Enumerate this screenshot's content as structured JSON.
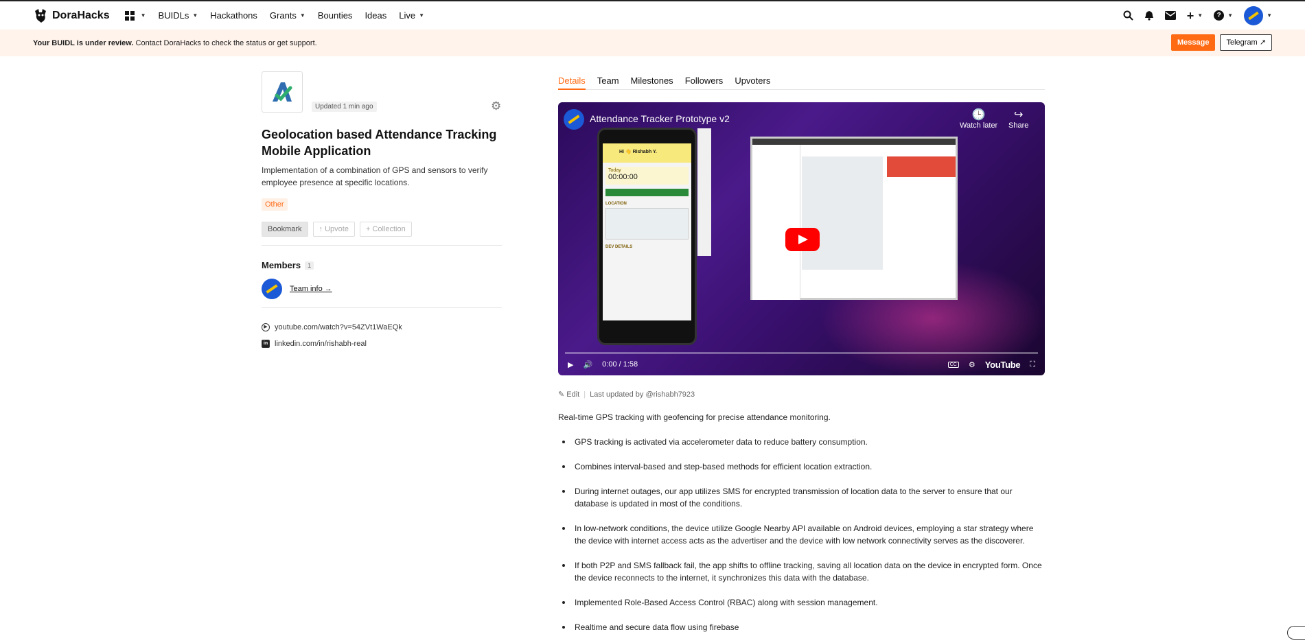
{
  "header": {
    "brand": "DoraHacks",
    "nav": [
      "BUIDLs",
      "Hackathons",
      "Grants",
      "Bounties",
      "Ideas",
      "Live"
    ]
  },
  "banner": {
    "bold": "Your BUIDL is under review.",
    "text": " Contact DoraHacks to check the status or get support.",
    "message_label": "Message",
    "telegram_label": "Telegram ↗"
  },
  "project": {
    "updated": "Updated 1 min ago",
    "title": "Geolocation based Attendance Tracking Mobile Application",
    "description": "Implementation of a combination of GPS and sensors to verify employee presence at specific locations.",
    "tag": "Other",
    "actions": [
      "Bookmark",
      "↑ Upvote",
      "+ Collection"
    ],
    "members_label": "Members",
    "members_count": "1",
    "team_info": "Team info →",
    "links": [
      "youtube.com/watch?v=54ZVt1WaEQk",
      "linkedin.com/in/rishabh-real"
    ]
  },
  "tabs": [
    "Details",
    "Team",
    "Milestones",
    "Followers",
    "Upvoters"
  ],
  "video": {
    "title": "Attendance Tracker Prototype v2",
    "watch_later": "Watch later",
    "share": "Share",
    "time": "0:00 / 1:58",
    "yt_label": "YouTube",
    "phone_user": "Hi 👋 Rishabh Y.",
    "phone_today": "Today",
    "phone_timer": "00:00:00",
    "phone_location": "LOCATION",
    "phone_dev": "DEV DETAILS"
  },
  "meta": {
    "edit": "Edit",
    "updated_by": "Last updated by @rishabh7923"
  },
  "content": {
    "intro": "Real-time GPS tracking with geofencing for precise attendance monitoring.",
    "bullets": [
      "GPS tracking is activated via accelerometer data to reduce battery consumption.",
      "Combines interval-based and step-based methods for efficient location extraction.",
      "During internet outages, our app utilizes SMS for encrypted transmission of location data to the server to ensure that our database is updated in most of the conditions.",
      "In low-network conditions, the device utilize Google Nearby API available on Android devices, employing a star strategy where the device with internet access acts as the advertiser and the device with low network connectivity serves as the discoverer.",
      "If both P2P and SMS fallback fail, the app shifts to offline tracking, saving all location data on the device in encrypted form. Once the device reconnects to the internet, it synchronizes this data with the database.",
      "Implemented Role-Based Access Control (RBAC) along with session management.",
      "Realtime and secure data flow using firebase"
    ]
  },
  "colors": {
    "accent": "#ff6a13",
    "banner_bg": "#fff3ec"
  },
  "icons": [
    "search-icon",
    "bell-icon",
    "mail-icon",
    "plus-icon",
    "help-icon",
    "gear-icon",
    "youtube-icon",
    "linkedin-icon",
    "play-icon"
  ]
}
